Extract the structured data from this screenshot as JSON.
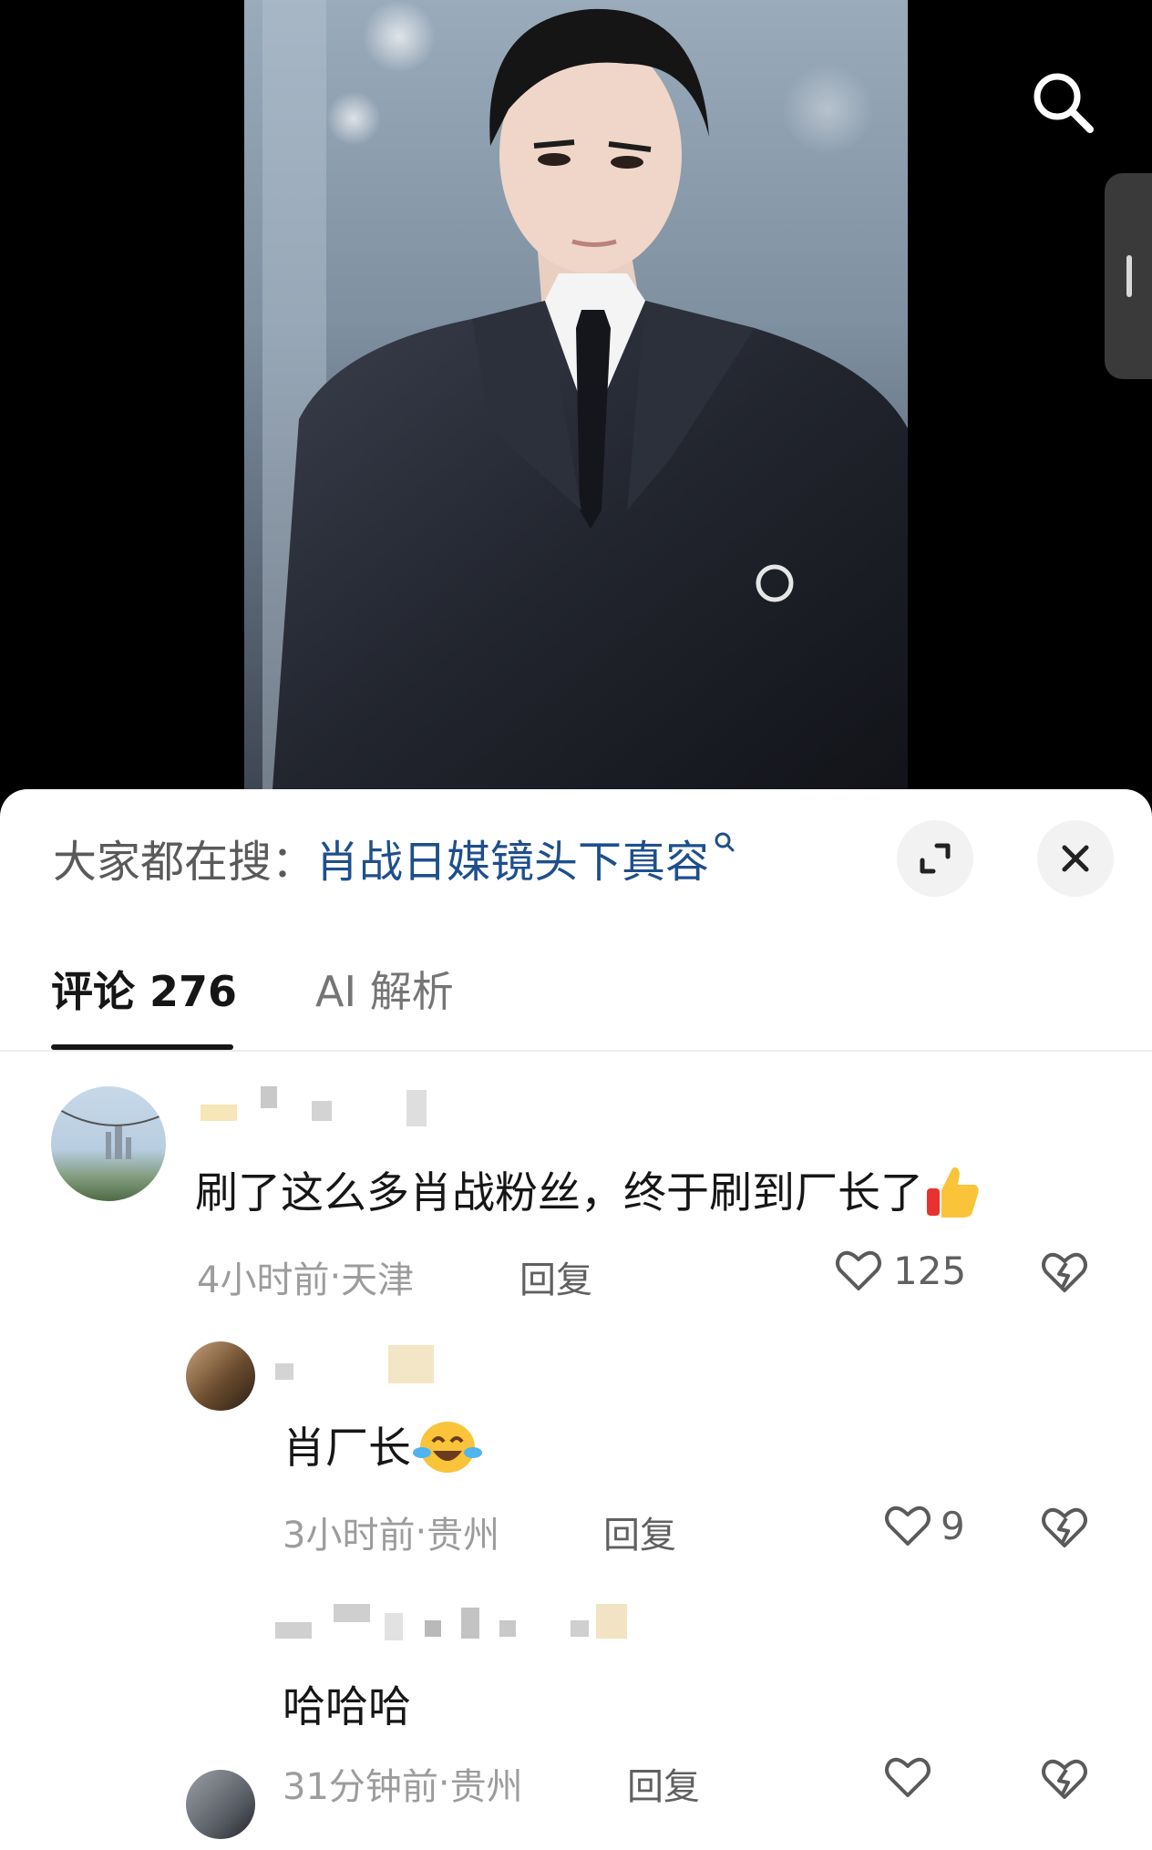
{
  "video": {
    "search_icon": "search-icon",
    "photo_description_icon": "portrait-photo"
  },
  "sheet": {
    "trending_prefix": "大家都在搜：",
    "trending_topic": "肖战日媒镜头下真容",
    "tabs": [
      {
        "label": "评论 276"
      },
      {
        "label": "AI 解析"
      }
    ]
  },
  "comments": [
    {
      "text": "刷了这么多肖战粉丝，终于刷到厂长了",
      "emoji": "thumbs-up-icon",
      "time": "4小时前",
      "location": "天津",
      "reply_label": "回复",
      "likes": "125"
    },
    {
      "text": "肖厂长",
      "emoji": "tears-of-joy-icon",
      "time": "3小时前",
      "location": "贵州",
      "reply_label": "回复",
      "likes": "9"
    },
    {
      "text": "哈哈哈",
      "time": "31分钟前",
      "location": "贵州",
      "reply_label": "回复",
      "likes": ""
    }
  ],
  "meta_separator": " · ",
  "colors": {
    "topic_link": "#1e4f8c",
    "text_primary": "#161616",
    "text_meta": "#9c9c9c"
  }
}
